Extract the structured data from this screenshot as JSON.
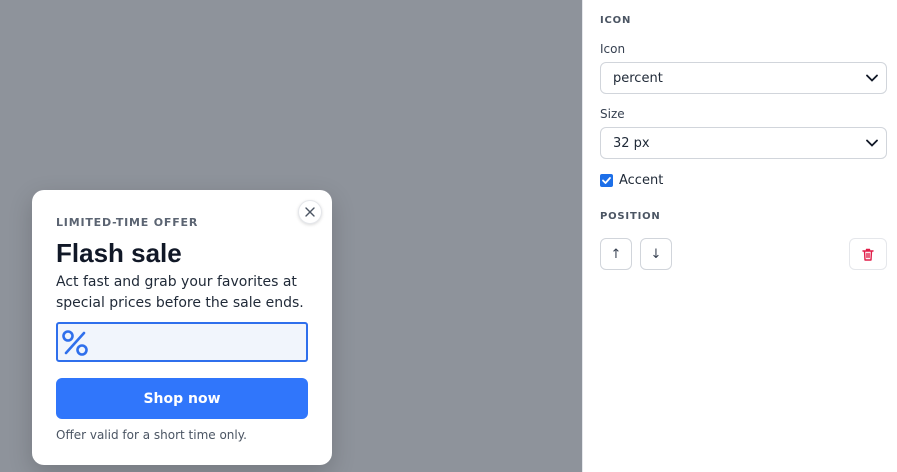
{
  "popup": {
    "eyebrow": "LIMITED-TIME OFFER",
    "headline": "Flash sale",
    "body": "Act fast and grab your favorites at special prices before the sale ends.",
    "icon": "percent-icon",
    "cta_label": "Shop now",
    "footnote": "Offer valid for a short time only.",
    "close_icon": "close-icon"
  },
  "panel": {
    "icon_section_title": "ICON",
    "icon_label": "Icon",
    "icon_value": "percent",
    "size_label": "Size",
    "size_value": "32 px",
    "accent_label": "Accent",
    "accent_checked": true,
    "position_section_title": "POSITION",
    "move_up_label": "↑",
    "move_down_label": "↓",
    "delete_icon": "trash-icon"
  },
  "colors": {
    "canvas": "#8e939b",
    "accent": "#3076fb",
    "icon_accent": "#2f6fec",
    "danger": "#e11d48"
  }
}
